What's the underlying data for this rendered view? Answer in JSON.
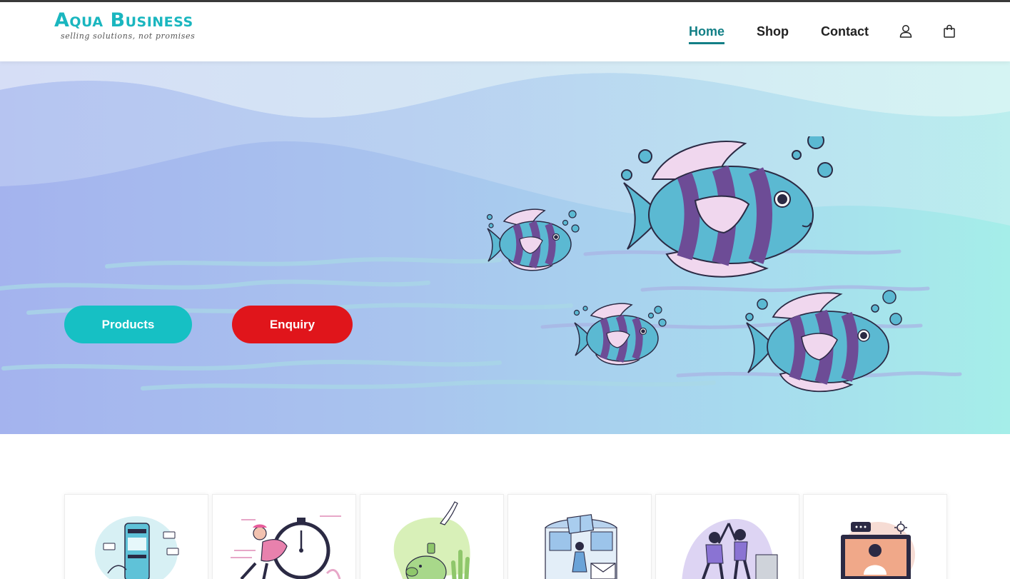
{
  "brand": {
    "name": "Aqua Business",
    "tagline": "selling solutions, not promises"
  },
  "nav": {
    "items": [
      {
        "label": "Home",
        "active": true
      },
      {
        "label": "Shop",
        "active": false
      },
      {
        "label": "Contact",
        "active": false
      }
    ],
    "icons": [
      "user-icon",
      "shopping-bag-icon"
    ]
  },
  "hero": {
    "buttons": {
      "products": "Products",
      "enquiry": "Enquiry"
    }
  },
  "features": {
    "cards": [
      {
        "illustration": "mobile-payment-illustration"
      },
      {
        "illustration": "fast-delivery-stopwatch-illustration"
      },
      {
        "illustration": "piggy-bank-savings-illustration"
      },
      {
        "illustration": "gift-shop-illustration"
      },
      {
        "illustration": "team-high-five-illustration"
      },
      {
        "illustration": "online-support-laptop-illustration"
      }
    ]
  },
  "colors": {
    "brand_teal": "#1ab6bf",
    "nav_active": "#127f86",
    "products_button": "#16c0c4",
    "enquiry_button": "#e0151b",
    "fish_blue": "#5bb9d2",
    "fish_purple": "#6d4c96",
    "fish_pink": "#f0d7ee"
  }
}
